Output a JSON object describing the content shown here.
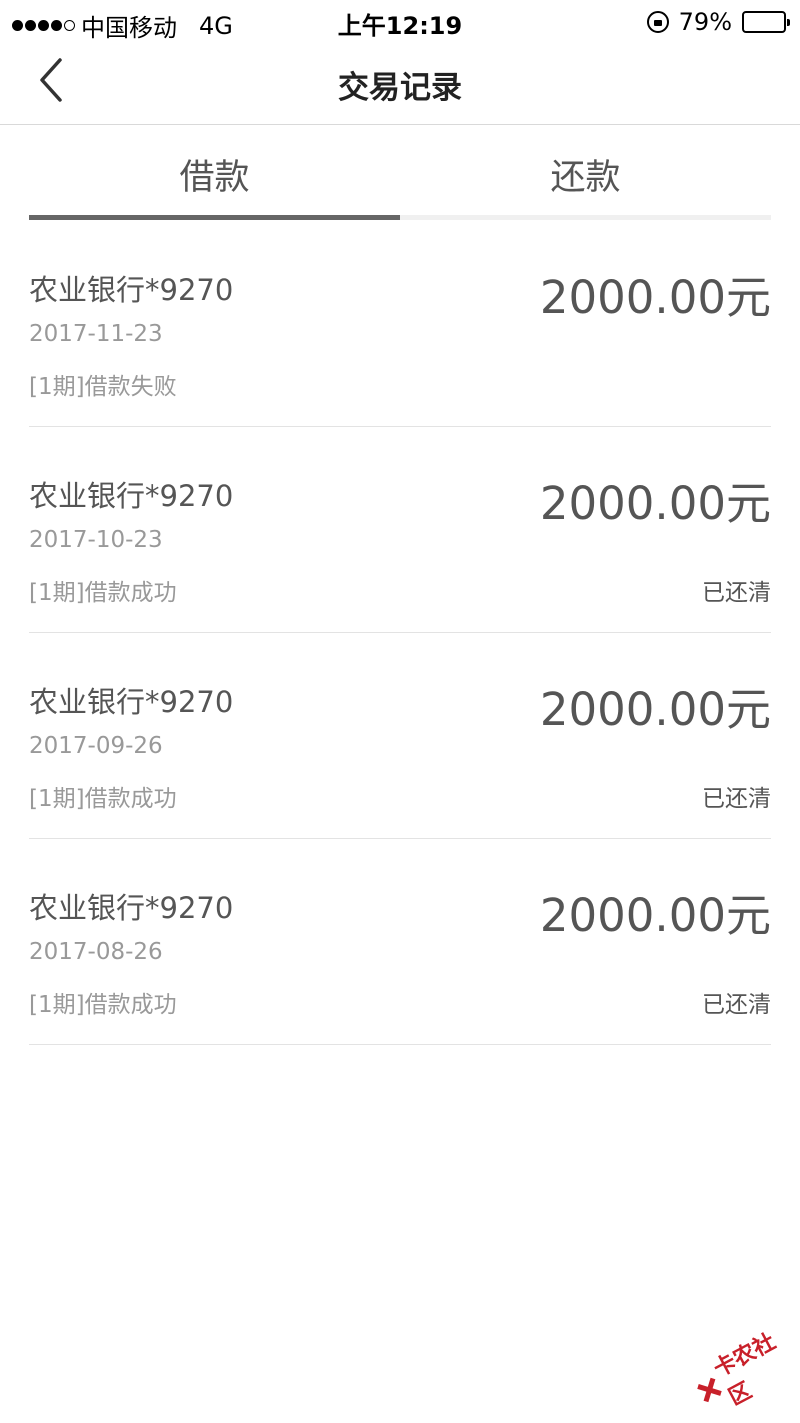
{
  "status_bar": {
    "carrier": "中国移动",
    "network": "4G",
    "time": "上午12:19",
    "battery": "79%",
    "battery_level": 0.79
  },
  "nav": {
    "title": "交易记录",
    "back_icon": "chevron-left-icon"
  },
  "tabs": [
    {
      "label": "借款",
      "active": true
    },
    {
      "label": "还款",
      "active": false
    }
  ],
  "transactions": [
    {
      "bank": "农业银行*9270",
      "date": "2017-11-23",
      "status": "[1期]借款失败",
      "amount": "2000.00元",
      "repaid": ""
    },
    {
      "bank": "农业银行*9270",
      "date": "2017-10-23",
      "status": "[1期]借款成功",
      "amount": "2000.00元",
      "repaid": "已还清"
    },
    {
      "bank": "农业银行*9270",
      "date": "2017-09-26",
      "status": "[1期]借款成功",
      "amount": "2000.00元",
      "repaid": "已还清"
    },
    {
      "bank": "农业银行*9270",
      "date": "2017-08-26",
      "status": "[1期]借款成功",
      "amount": "2000.00元",
      "repaid": "已还清"
    }
  ],
  "watermark": "卡农社区",
  "colors": {
    "tab_indicator": "#666666",
    "watermark": "#c8202a"
  }
}
